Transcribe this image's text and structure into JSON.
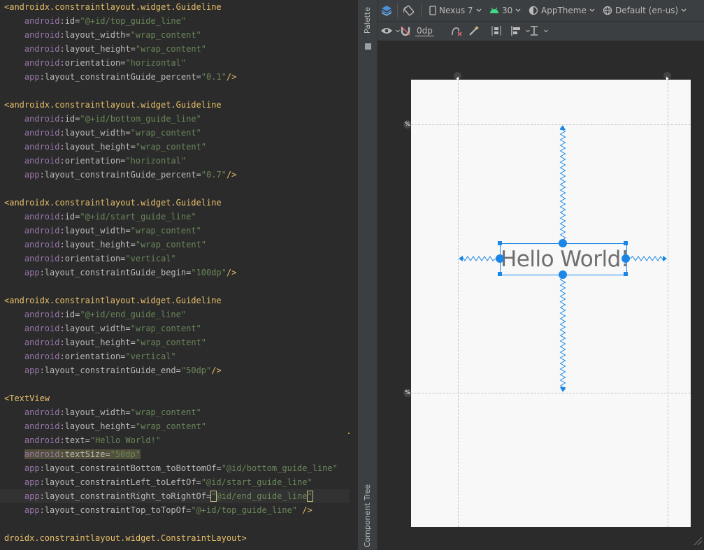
{
  "editor": {
    "lines": [
      [
        [
          "tag",
          "<androidx.constraintlayout.widget.Guideline"
        ]
      ],
      [
        [
          "sp",
          "    "
        ],
        [
          "ns",
          "android"
        ],
        [
          "attr",
          ":id="
        ],
        [
          "val",
          "\"@+id/top_guide_line\""
        ]
      ],
      [
        [
          "sp",
          "    "
        ],
        [
          "ns",
          "android"
        ],
        [
          "attr",
          ":layout_width="
        ],
        [
          "val",
          "\"wrap_content\""
        ]
      ],
      [
        [
          "sp",
          "    "
        ],
        [
          "ns",
          "android"
        ],
        [
          "attr",
          ":layout_height="
        ],
        [
          "val",
          "\"wrap_content\""
        ]
      ],
      [
        [
          "sp",
          "    "
        ],
        [
          "ns",
          "android"
        ],
        [
          "attr",
          ":orientation="
        ],
        [
          "val",
          "\"horizontal\""
        ]
      ],
      [
        [
          "sp",
          "    "
        ],
        [
          "ns",
          "app"
        ],
        [
          "attr",
          ":layout_constraintGuide_percent="
        ],
        [
          "val",
          "\"0.1\""
        ],
        [
          "tag",
          "/>"
        ]
      ],
      [],
      [
        [
          "tag",
          "<androidx.constraintlayout.widget.Guideline"
        ]
      ],
      [
        [
          "sp",
          "    "
        ],
        [
          "ns",
          "android"
        ],
        [
          "attr",
          ":id="
        ],
        [
          "val",
          "\"@+id/bottom_guide_line\""
        ]
      ],
      [
        [
          "sp",
          "    "
        ],
        [
          "ns",
          "android"
        ],
        [
          "attr",
          ":layout_width="
        ],
        [
          "val",
          "\"wrap_content\""
        ]
      ],
      [
        [
          "sp",
          "    "
        ],
        [
          "ns",
          "android"
        ],
        [
          "attr",
          ":layout_height="
        ],
        [
          "val",
          "\"wrap_content\""
        ]
      ],
      [
        [
          "sp",
          "    "
        ],
        [
          "ns",
          "android"
        ],
        [
          "attr",
          ":orientation="
        ],
        [
          "val",
          "\"horizontal\""
        ]
      ],
      [
        [
          "sp",
          "    "
        ],
        [
          "ns",
          "app"
        ],
        [
          "attr",
          ":layout_constraintGuide_percent="
        ],
        [
          "val",
          "\"0.7\""
        ],
        [
          "tag",
          "/>"
        ]
      ],
      [],
      [
        [
          "tag",
          "<androidx.constraintlayout.widget.Guideline"
        ]
      ],
      [
        [
          "sp",
          "    "
        ],
        [
          "ns",
          "android"
        ],
        [
          "attr",
          ":id="
        ],
        [
          "val",
          "\"@+id/start_guide_line\""
        ]
      ],
      [
        [
          "sp",
          "    "
        ],
        [
          "ns",
          "android"
        ],
        [
          "attr",
          ":layout_width="
        ],
        [
          "val",
          "\"wrap_content\""
        ]
      ],
      [
        [
          "sp",
          "    "
        ],
        [
          "ns",
          "android"
        ],
        [
          "attr",
          ":layout_height="
        ],
        [
          "val",
          "\"wrap_content\""
        ]
      ],
      [
        [
          "sp",
          "    "
        ],
        [
          "ns",
          "android"
        ],
        [
          "attr",
          ":orientation="
        ],
        [
          "val",
          "\"vertical\""
        ]
      ],
      [
        [
          "sp",
          "    "
        ],
        [
          "ns",
          "app"
        ],
        [
          "attr",
          ":layout_constraintGuide_begin="
        ],
        [
          "val",
          "\"100dp\""
        ],
        [
          "tag",
          "/>"
        ]
      ],
      [],
      [
        [
          "tag",
          "<androidx.constraintlayout.widget.Guideline"
        ]
      ],
      [
        [
          "sp",
          "    "
        ],
        [
          "ns",
          "android"
        ],
        [
          "attr",
          ":id="
        ],
        [
          "val",
          "\"@+id/end_guide_line\""
        ]
      ],
      [
        [
          "sp",
          "    "
        ],
        [
          "ns",
          "android"
        ],
        [
          "attr",
          ":layout_width="
        ],
        [
          "val",
          "\"wrap_content\""
        ]
      ],
      [
        [
          "sp",
          "    "
        ],
        [
          "ns",
          "android"
        ],
        [
          "attr",
          ":layout_height="
        ],
        [
          "val",
          "\"wrap_content\""
        ]
      ],
      [
        [
          "sp",
          "    "
        ],
        [
          "ns",
          "android"
        ],
        [
          "attr",
          ":orientation="
        ],
        [
          "val",
          "\"vertical\""
        ]
      ],
      [
        [
          "sp",
          "    "
        ],
        [
          "ns",
          "app"
        ],
        [
          "attr",
          ":layout_constraintGuide_end="
        ],
        [
          "val",
          "\"50dp\""
        ],
        [
          "tag",
          "/>"
        ]
      ],
      [],
      [
        [
          "tag",
          "<TextView"
        ]
      ],
      [
        [
          "sp",
          "    "
        ],
        [
          "ns",
          "android"
        ],
        [
          "attr",
          ":layout_width="
        ],
        [
          "val",
          "\"wrap_content\""
        ]
      ],
      [
        [
          "sp",
          "    "
        ],
        [
          "ns",
          "android"
        ],
        [
          "attr",
          ":layout_height="
        ],
        [
          "val",
          "\"wrap_content\""
        ]
      ],
      [
        [
          "sp",
          "    "
        ],
        [
          "ns",
          "android"
        ],
        [
          "attr",
          ":text="
        ],
        [
          "val",
          "\"Hello World!\""
        ]
      ],
      [
        [
          "sp",
          "    "
        ],
        [
          "ns hl",
          "android"
        ],
        [
          "attr hl",
          ":textSize="
        ],
        [
          "val hl",
          "\"50dp\""
        ]
      ],
      [
        [
          "sp",
          "    "
        ],
        [
          "ns",
          "app"
        ],
        [
          "attr",
          ":layout_constraintBottom_toBottomOf="
        ],
        [
          "val",
          "\"@id/bottom_guide_line\""
        ]
      ],
      [
        [
          "sp",
          "    "
        ],
        [
          "ns",
          "app"
        ],
        [
          "attr",
          ":layout_constraintLeft_toLeftOf="
        ],
        [
          "val",
          "\"@id/start_guide_line\""
        ]
      ],
      [
        [
          "sp",
          "    "
        ],
        [
          "ns",
          "app"
        ],
        [
          "attr",
          ":layout_constraintRight_toRightOf="
        ],
        [
          "val caret-box",
          "\""
        ],
        [
          "val",
          "@id/end_guide_line"
        ],
        [
          "val caret-box",
          "\""
        ]
      ],
      [
        [
          "sp",
          "    "
        ],
        [
          "ns",
          "app"
        ],
        [
          "attr",
          ":layout_constraintTop_toTopOf="
        ],
        [
          "val",
          "\"@+id/top_guide_line\""
        ],
        [
          "tag",
          " />"
        ]
      ],
      [],
      [
        [
          "tag",
          "droidx.constraintlayout.widget.ConstraintLayout>"
        ]
      ]
    ],
    "current_line": 35
  },
  "side_strip": {
    "palette_label": "Palette",
    "component_tree_label": "Component Tree"
  },
  "toolbar": {
    "device": "Nexus 7",
    "api": "30",
    "theme": "AppTheme",
    "locale": "Default (en-us)",
    "margin": "0dp"
  },
  "design": {
    "textview_text": "Hello World!",
    "accent_color": "#1a86e8",
    "guide_badge": "%"
  }
}
